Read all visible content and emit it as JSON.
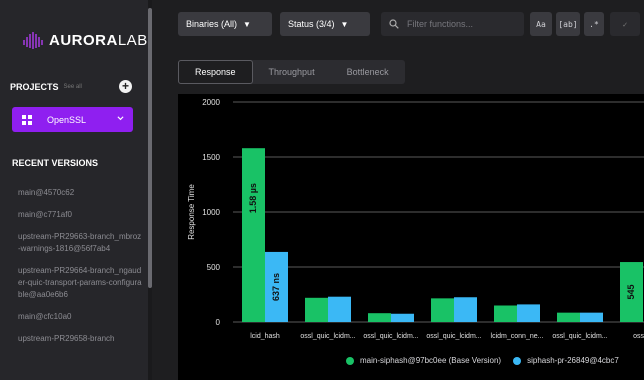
{
  "brand": {
    "name_bold": "AURORA",
    "name_light": "LABS"
  },
  "projects": {
    "title": "PROJECTS",
    "see_all": "See all",
    "add_symbol": "+",
    "selected": "OpenSSL"
  },
  "recent": {
    "title": "RECENT VERSIONS",
    "items": [
      "main@4570c62",
      "main@c771af0",
      "upstream-PR29663-branch_mbroz-warnings-1816@56f7ab4",
      "upstream-PR29664-branch_ngauder-quic-transport-params-configurable@aa0e6b6",
      "main@cfc10a0",
      "upstream-PR29658-branch"
    ]
  },
  "toolbar": {
    "binaries": "Binaries (All)",
    "status": "Status (3/4)",
    "search_placeholder": "Filter functions...",
    "case_btn": "Aa",
    "word_btn": "[ab]",
    "regex_btn": ".*",
    "check_btn": "✓"
  },
  "tabs": [
    "Response",
    "Throughput",
    "Bottleneck"
  ],
  "colors": {
    "accent": "#8f1ff0",
    "base": "#19c266",
    "pr": "#3bb8f5"
  },
  "chart_data": {
    "type": "bar",
    "ylabel": "Response Time",
    "ylim": [
      0,
      2000
    ],
    "yticks": [
      0,
      500,
      1000,
      1500,
      2000
    ],
    "categories": [
      "lcid_hash",
      "ossl_quic_lcidm...",
      "ossl_quic_lcidm...",
      "ossl_quic_lcidm...",
      "lcidm_conn_ne...",
      "ossl_quic_lcidm...",
      "ossl_c"
    ],
    "series": [
      {
        "name": "main-siphash@97bc0ee (Base Version)",
        "values": [
          1580,
          220,
          80,
          215,
          150,
          85,
          545
        ],
        "labels": [
          "1.58 µs",
          "",
          "",
          "",
          "",
          "",
          "545"
        ]
      },
      {
        "name": "siphash-pr-26849@4cbc7",
        "values": [
          637,
          230,
          75,
          225,
          160,
          85,
          null
        ],
        "labels": [
          "637 ns",
          "",
          "",
          "",
          "",
          "",
          ""
        ]
      }
    ]
  }
}
